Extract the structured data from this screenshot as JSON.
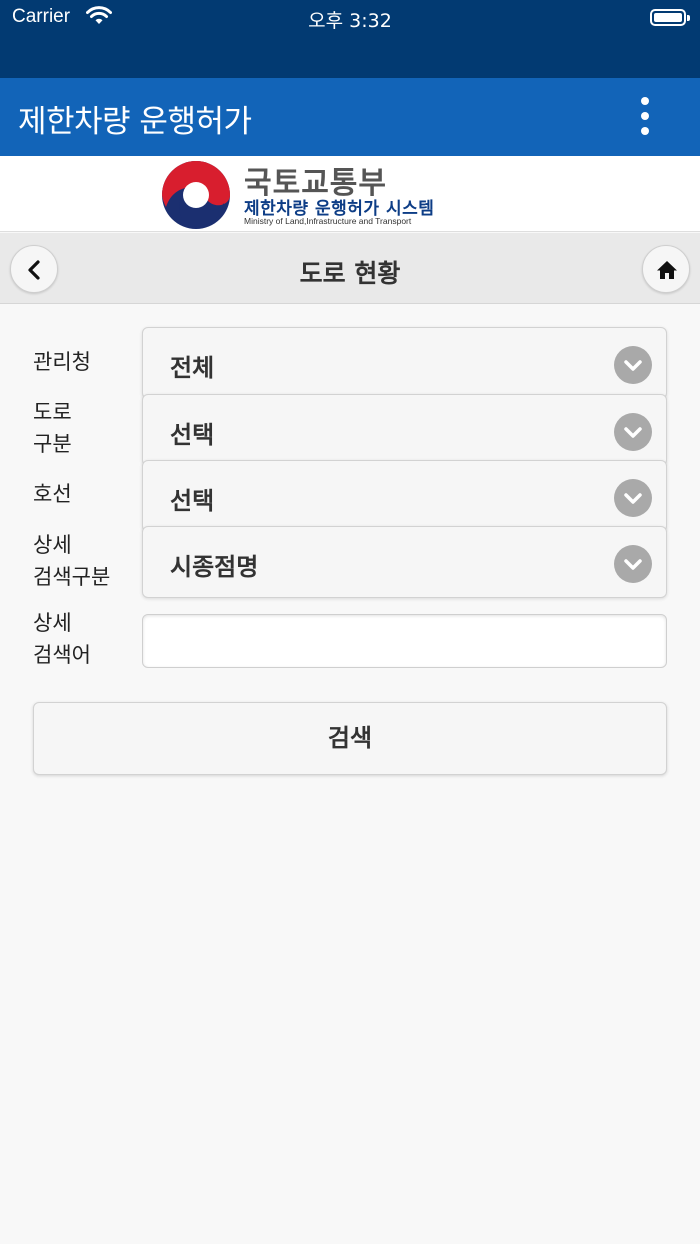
{
  "status_bar": {
    "carrier": "Carrier",
    "time": "오후 3:32"
  },
  "app": {
    "title": "제한차량 운행허가"
  },
  "banner": {
    "ministry_name": "국토교통부",
    "system_name": "제한차량 운행허가 시스템",
    "ministry_en": "Ministry of Land,Infrastructure and Transport"
  },
  "page": {
    "title": "도로 현황"
  },
  "form": {
    "office_label": "관리청",
    "office_value": "전체",
    "road_type_label_1": "도로",
    "road_type_label_2": "구분",
    "road_type_value": "선택",
    "route_label": "호선",
    "route_value": "선택",
    "detail_type_label_1": "상세",
    "detail_type_label_2": "검색구분",
    "detail_type_value": "시종점명",
    "keyword_label_1": "상세",
    "keyword_label_2": "검색어",
    "keyword_value": "",
    "search_label": "검색"
  },
  "colors": {
    "status_bar": "#023a72",
    "header": "#1264b8",
    "background": "#f8f8f8"
  },
  "icons": {
    "back": "chevron-left-icon",
    "home": "home-icon",
    "menu": "kebab-menu-icon",
    "dropdown": "chevron-down-circle-icon"
  }
}
